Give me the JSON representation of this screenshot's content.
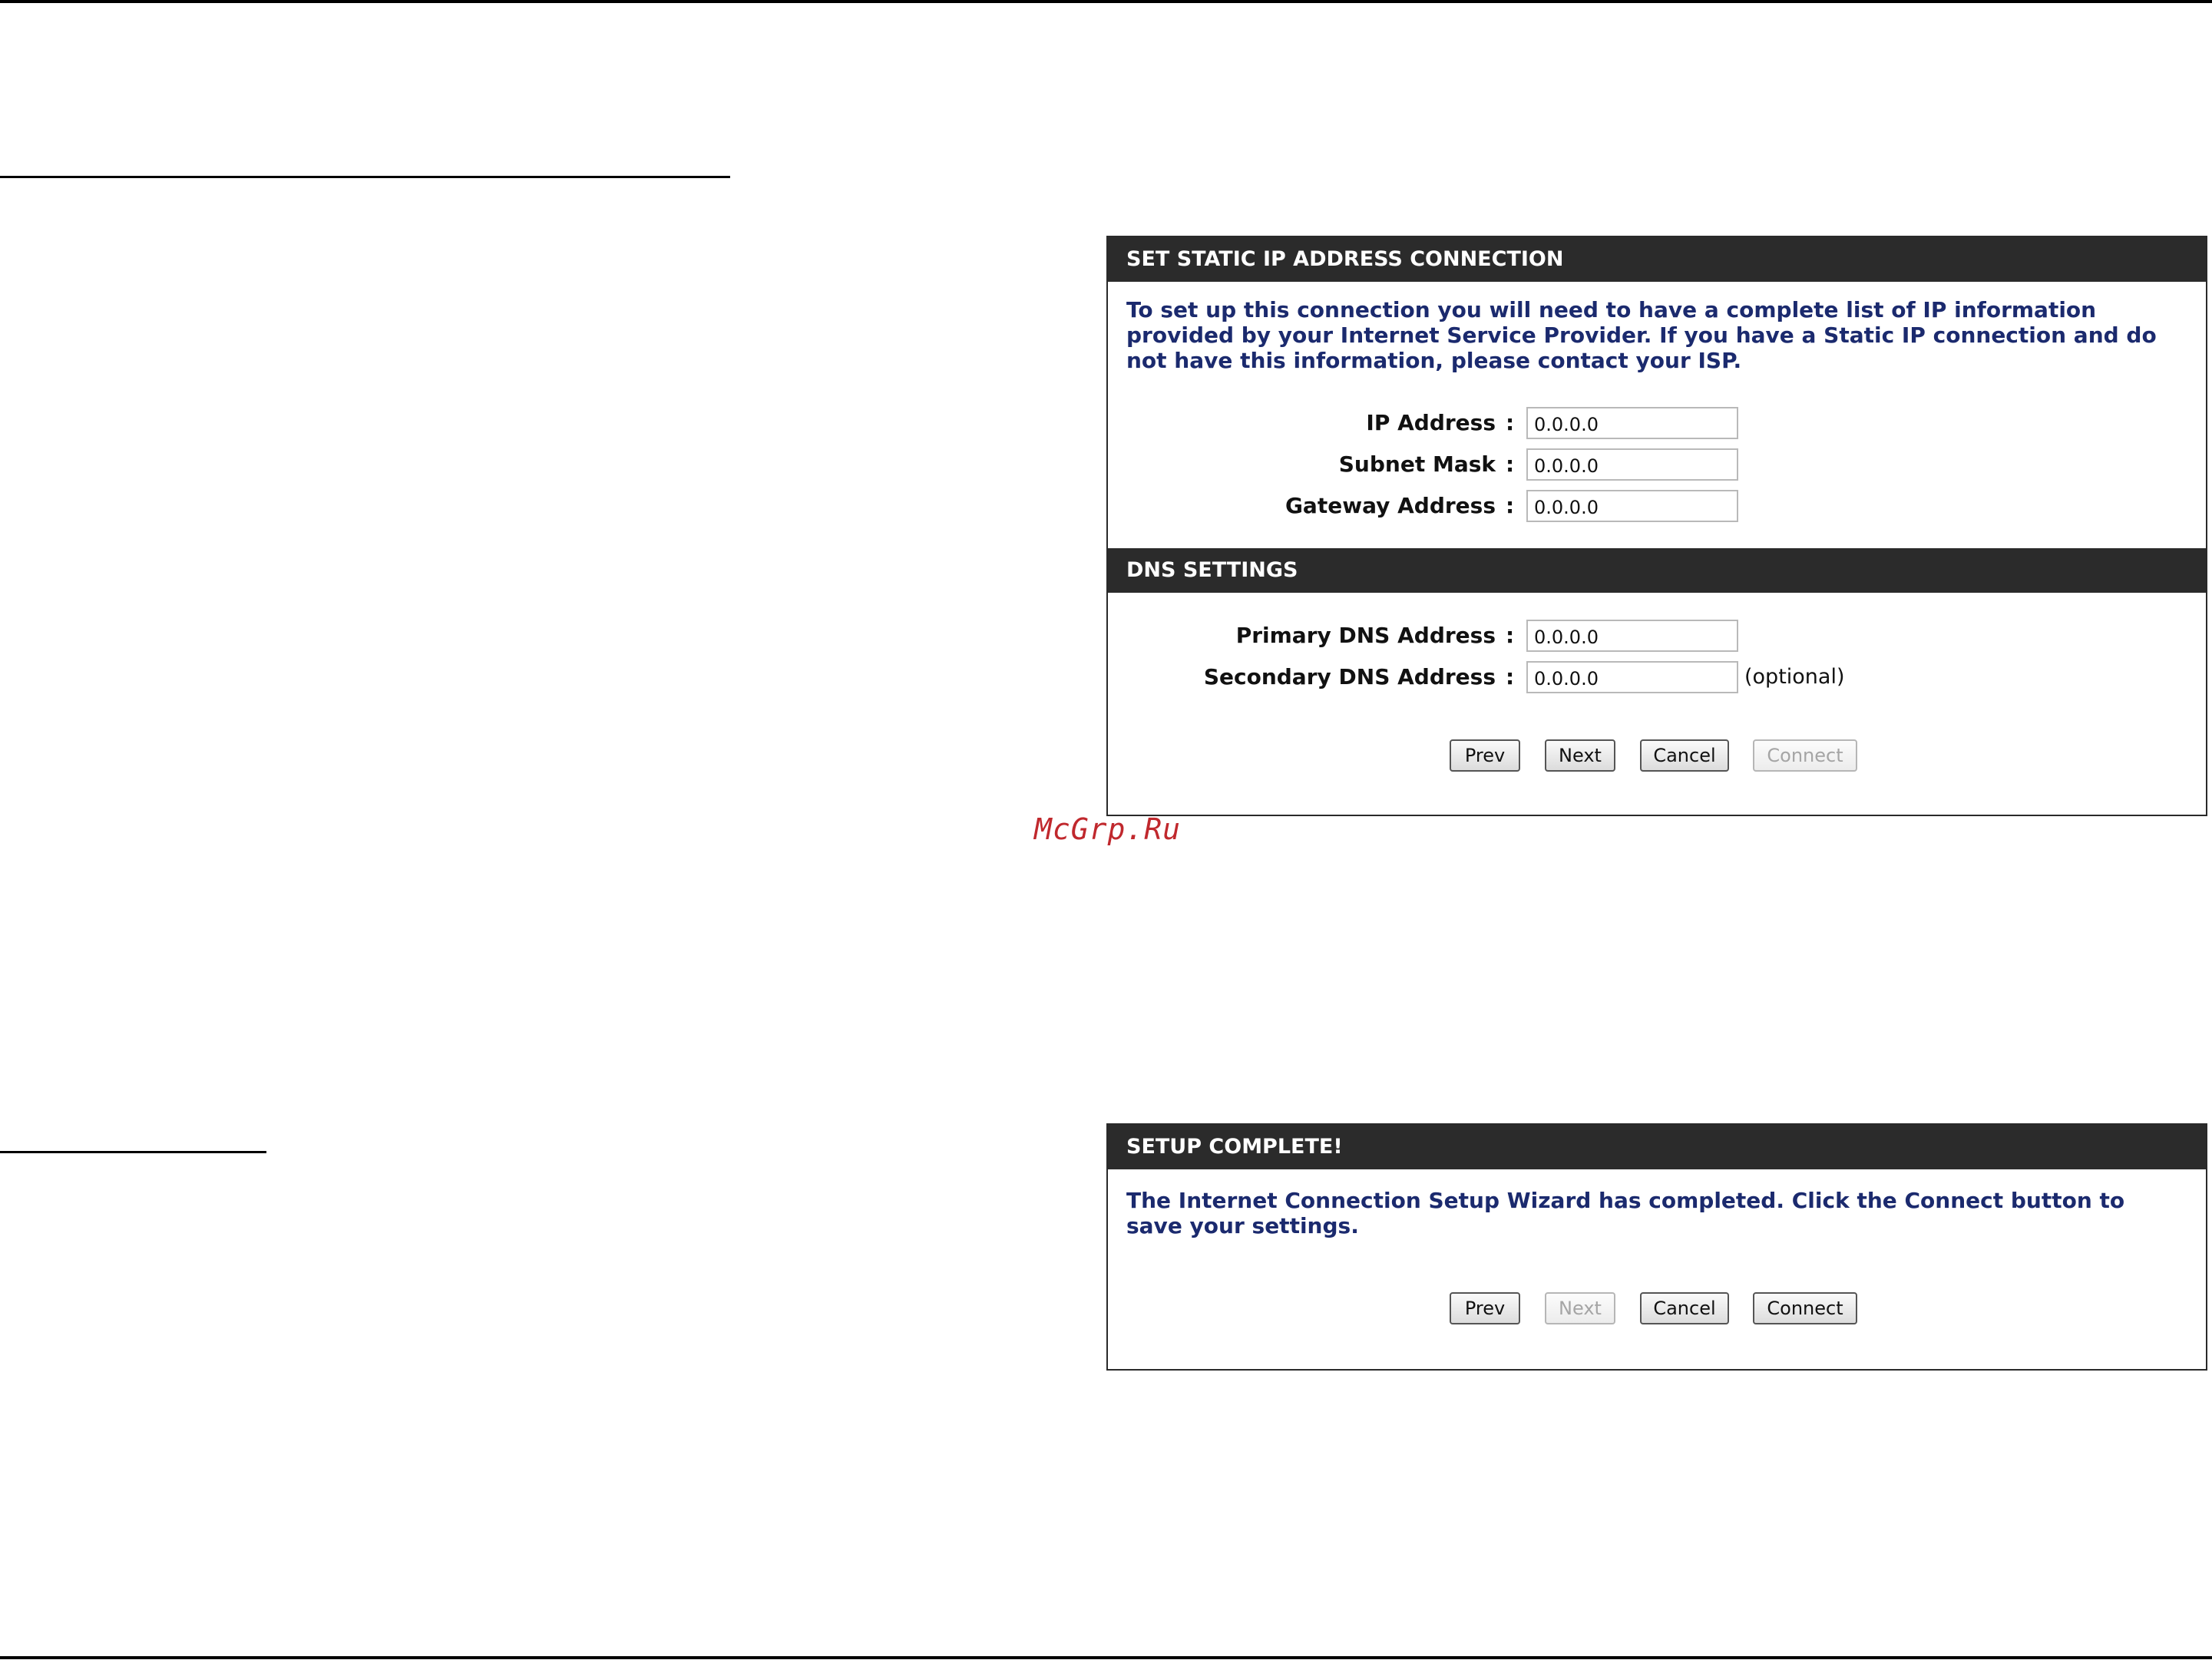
{
  "watermark": "McGrp.Ru",
  "static_ip_panel": {
    "title": "SET STATIC IP ADDRESS CONNECTION",
    "intro": "To set up this connection you will need to have a complete list of IP information provided by your Internet Service Provider. If you have a Static IP connection and do not have this information, please contact your ISP.",
    "fields": [
      {
        "label": "IP Address",
        "value": "0.0.0.0"
      },
      {
        "label": "Subnet Mask",
        "value": "0.0.0.0"
      },
      {
        "label": "Gateway Address",
        "value": "0.0.0.0"
      }
    ],
    "dns_title": "DNS SETTINGS",
    "dns_fields": [
      {
        "label": "Primary DNS Address",
        "value": "0.0.0.0"
      },
      {
        "label": "Secondary DNS Address",
        "value": "0.0.0.0",
        "note": "(optional)"
      }
    ],
    "colon": ":",
    "buttons": {
      "prev": "Prev",
      "next": "Next",
      "cancel": "Cancel",
      "connect": "Connect",
      "connect_enabled": false
    }
  },
  "setup_complete_panel": {
    "title": "SETUP COMPLETE!",
    "intro": "The Internet Connection Setup Wizard has completed. Click the Connect button to save your settings.",
    "buttons": {
      "prev": "Prev",
      "next": "Next",
      "cancel": "Cancel",
      "connect": "Connect",
      "next_enabled": false
    }
  }
}
